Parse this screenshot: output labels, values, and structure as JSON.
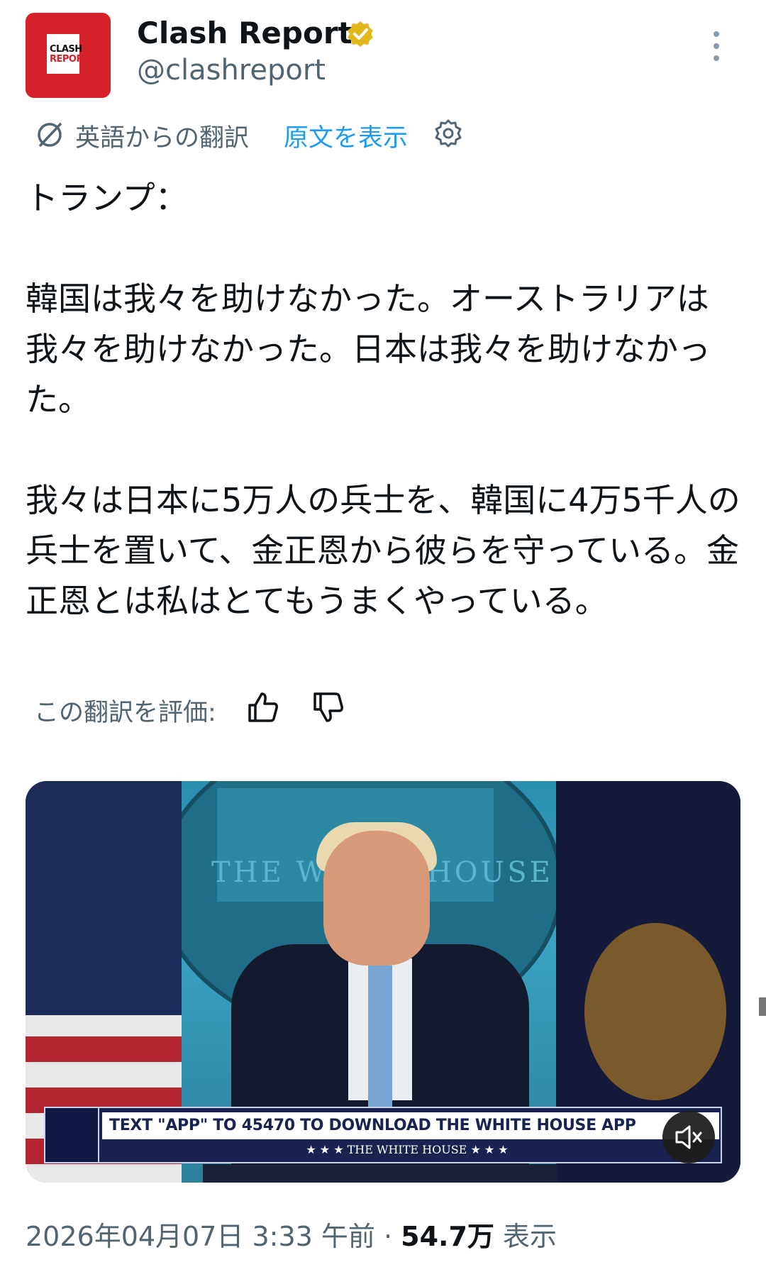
{
  "account": {
    "name": "Clash Report",
    "handle": "@clashreport",
    "avatar_line1": "CLASH",
    "avatar_line2": "REPORT",
    "verified_color": "#e2b719",
    "brand_color": "#d6202a"
  },
  "translation_bar": {
    "label": "英語からの翻訳",
    "show_original": "原文を表示",
    "icon": "translate-icon",
    "settings_icon": "gear-icon"
  },
  "post": {
    "text": "トランプ：\n\n韓国は我々を助けなかった。オーストラリアは我々を助けなかった。日本は我々を助けなかった。\n\n我々は日本に5万人の兵士を、韓国に4万5千人の兵士を置いて、金正恩から彼らを守っている。金正恩とは私はとてもうまくやっている。"
  },
  "rate": {
    "label": "この翻訳を評価:",
    "up_icon": "thumbs-up-icon",
    "down_icon": "thumbs-down-icon"
  },
  "media": {
    "seal_text": "THE WHITE HOUSE",
    "chyron_top": "TEXT \"APP\" TO 45470 TO DOWNLOAD THE WHITE HOUSE APP",
    "chyron_bottom": "★ ★ ★  THE WHITE HOUSE  ★ ★ ★",
    "mute_icon": "muted-speaker-icon"
  },
  "meta": {
    "date": "2026年04月07日 3:33 午前 · ",
    "views_count": "54.7万",
    "views_label": " 表示"
  }
}
